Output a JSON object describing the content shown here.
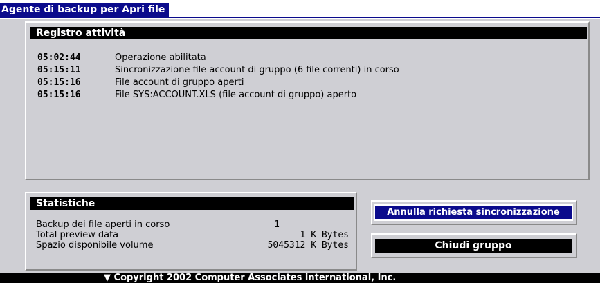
{
  "window": {
    "title": "Agente di backup per Apri file"
  },
  "log_panel": {
    "header": "Registro attività",
    "entries": [
      {
        "time": "05:02:44",
        "message": "Operazione abilitata"
      },
      {
        "time": "05:15:11",
        "message": "Sincronizzazione file account di gruppo (6 file correnti) in corso"
      },
      {
        "time": "05:15:16",
        "message": "File account di gruppo aperti"
      },
      {
        "time": "05:15:16",
        "message": "File SYS:ACCOUNT.XLS (file account di gruppo) aperto"
      }
    ]
  },
  "stats_panel": {
    "header": "Statistiche",
    "rows": [
      {
        "label": "Backup dei file aperti in corso",
        "value": "1"
      },
      {
        "label": "Total preview data",
        "value": "1 K Bytes"
      },
      {
        "label": "Spazio disponibile volume",
        "value": "5045312 K Bytes"
      }
    ]
  },
  "buttons": {
    "cancel_sync": "Annulla richiesta sincronizzazione",
    "close_group": "Chiudi gruppo"
  },
  "footer": {
    "text": "▼ Copyright 2002 Computer Associates international, Inc."
  },
  "colors": {
    "title_bar": "#0b0b8c",
    "background": "#cfcfd4",
    "header_bar": "#000000"
  }
}
